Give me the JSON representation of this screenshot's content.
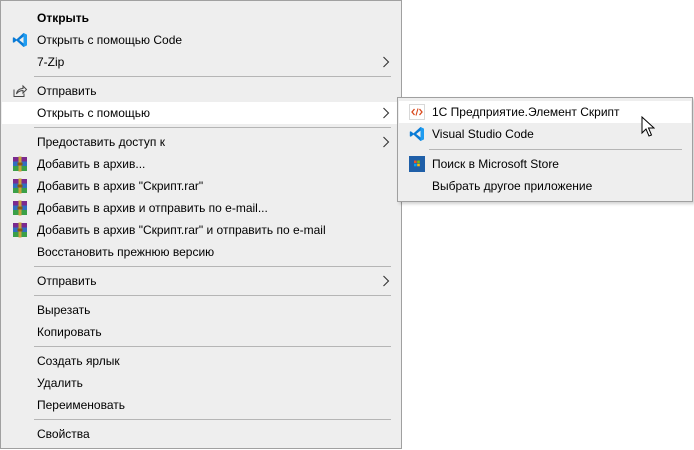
{
  "context_menu": {
    "items": [
      {
        "label": "Открыть"
      },
      {
        "label": "Открыть с помощью Code",
        "icon": "vscode-icon"
      },
      {
        "label": "7-Zip"
      },
      {
        "label": "Отправить",
        "icon": "share-icon"
      },
      {
        "label": "Открыть с помощью"
      },
      {
        "label": "Предоставить доступ к"
      },
      {
        "label": "Добавить в архив...",
        "icon": "winrar-icon"
      },
      {
        "label": "Добавить в архив \"Скрипт.rar\"",
        "icon": "winrar-icon"
      },
      {
        "label": "Добавить в архив и отправить по e-mail...",
        "icon": "winrar-icon"
      },
      {
        "label": "Добавить в архив \"Скрипт.rar\" и отправить по e-mail",
        "icon": "winrar-icon"
      },
      {
        "label": "Восстановить прежнюю версию"
      },
      {
        "label": "Отправить"
      },
      {
        "label": "Вырезать"
      },
      {
        "label": "Копировать"
      },
      {
        "label": "Создать ярлык"
      },
      {
        "label": "Удалить"
      },
      {
        "label": "Переименовать"
      },
      {
        "label": "Свойства"
      }
    ]
  },
  "submenu": {
    "items": [
      {
        "label": "1С Предприятие.Элемент Скрипт",
        "icon": "1c-script-icon"
      },
      {
        "label": "Visual Studio Code",
        "icon": "vscode-icon"
      },
      {
        "label": "Поиск в Microsoft Store",
        "icon": "microsoft-store-icon"
      },
      {
        "label": "Выбрать другое приложение"
      }
    ]
  },
  "colors": {
    "menu_bg": "#eeeeee",
    "highlight_bg": "#ffffff",
    "separator": "#b5b5b5",
    "vscode_blue": "#0078d4"
  }
}
